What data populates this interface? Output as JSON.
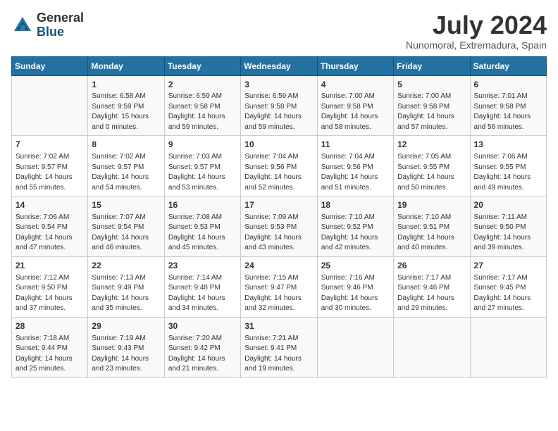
{
  "logo": {
    "general": "General",
    "blue": "Blue"
  },
  "title": "July 2024",
  "location": "Nunomoral, Extremadura, Spain",
  "days_of_week": [
    "Sunday",
    "Monday",
    "Tuesday",
    "Wednesday",
    "Thursday",
    "Friday",
    "Saturday"
  ],
  "weeks": [
    [
      {
        "day": "",
        "content": ""
      },
      {
        "day": "1",
        "content": "Sunrise: 6:58 AM\nSunset: 9:59 PM\nDaylight: 15 hours\nand 0 minutes."
      },
      {
        "day": "2",
        "content": "Sunrise: 6:59 AM\nSunset: 9:58 PM\nDaylight: 14 hours\nand 59 minutes."
      },
      {
        "day": "3",
        "content": "Sunrise: 6:59 AM\nSunset: 9:58 PM\nDaylight: 14 hours\nand 59 minutes."
      },
      {
        "day": "4",
        "content": "Sunrise: 7:00 AM\nSunset: 9:58 PM\nDaylight: 14 hours\nand 58 minutes."
      },
      {
        "day": "5",
        "content": "Sunrise: 7:00 AM\nSunset: 9:58 PM\nDaylight: 14 hours\nand 57 minutes."
      },
      {
        "day": "6",
        "content": "Sunrise: 7:01 AM\nSunset: 9:58 PM\nDaylight: 14 hours\nand 56 minutes."
      }
    ],
    [
      {
        "day": "7",
        "content": "Sunrise: 7:02 AM\nSunset: 9:57 PM\nDaylight: 14 hours\nand 55 minutes."
      },
      {
        "day": "8",
        "content": "Sunrise: 7:02 AM\nSunset: 9:57 PM\nDaylight: 14 hours\nand 54 minutes."
      },
      {
        "day": "9",
        "content": "Sunrise: 7:03 AM\nSunset: 9:57 PM\nDaylight: 14 hours\nand 53 minutes."
      },
      {
        "day": "10",
        "content": "Sunrise: 7:04 AM\nSunset: 9:56 PM\nDaylight: 14 hours\nand 52 minutes."
      },
      {
        "day": "11",
        "content": "Sunrise: 7:04 AM\nSunset: 9:56 PM\nDaylight: 14 hours\nand 51 minutes."
      },
      {
        "day": "12",
        "content": "Sunrise: 7:05 AM\nSunset: 9:55 PM\nDaylight: 14 hours\nand 50 minutes."
      },
      {
        "day": "13",
        "content": "Sunrise: 7:06 AM\nSunset: 9:55 PM\nDaylight: 14 hours\nand 49 minutes."
      }
    ],
    [
      {
        "day": "14",
        "content": "Sunrise: 7:06 AM\nSunset: 9:54 PM\nDaylight: 14 hours\nand 47 minutes."
      },
      {
        "day": "15",
        "content": "Sunrise: 7:07 AM\nSunset: 9:54 PM\nDaylight: 14 hours\nand 46 minutes."
      },
      {
        "day": "16",
        "content": "Sunrise: 7:08 AM\nSunset: 9:53 PM\nDaylight: 14 hours\nand 45 minutes."
      },
      {
        "day": "17",
        "content": "Sunrise: 7:09 AM\nSunset: 9:53 PM\nDaylight: 14 hours\nand 43 minutes."
      },
      {
        "day": "18",
        "content": "Sunrise: 7:10 AM\nSunset: 9:52 PM\nDaylight: 14 hours\nand 42 minutes."
      },
      {
        "day": "19",
        "content": "Sunrise: 7:10 AM\nSunset: 9:51 PM\nDaylight: 14 hours\nand 40 minutes."
      },
      {
        "day": "20",
        "content": "Sunrise: 7:11 AM\nSunset: 9:50 PM\nDaylight: 14 hours\nand 39 minutes."
      }
    ],
    [
      {
        "day": "21",
        "content": "Sunrise: 7:12 AM\nSunset: 9:50 PM\nDaylight: 14 hours\nand 37 minutes."
      },
      {
        "day": "22",
        "content": "Sunrise: 7:13 AM\nSunset: 9:49 PM\nDaylight: 14 hours\nand 35 minutes."
      },
      {
        "day": "23",
        "content": "Sunrise: 7:14 AM\nSunset: 9:48 PM\nDaylight: 14 hours\nand 34 minutes."
      },
      {
        "day": "24",
        "content": "Sunrise: 7:15 AM\nSunset: 9:47 PM\nDaylight: 14 hours\nand 32 minutes."
      },
      {
        "day": "25",
        "content": "Sunrise: 7:16 AM\nSunset: 9:46 PM\nDaylight: 14 hours\nand 30 minutes."
      },
      {
        "day": "26",
        "content": "Sunrise: 7:17 AM\nSunset: 9:46 PM\nDaylight: 14 hours\nand 29 minutes."
      },
      {
        "day": "27",
        "content": "Sunrise: 7:17 AM\nSunset: 9:45 PM\nDaylight: 14 hours\nand 27 minutes."
      }
    ],
    [
      {
        "day": "28",
        "content": "Sunrise: 7:18 AM\nSunset: 9:44 PM\nDaylight: 14 hours\nand 25 minutes."
      },
      {
        "day": "29",
        "content": "Sunrise: 7:19 AM\nSunset: 9:43 PM\nDaylight: 14 hours\nand 23 minutes."
      },
      {
        "day": "30",
        "content": "Sunrise: 7:20 AM\nSunset: 9:42 PM\nDaylight: 14 hours\nand 21 minutes."
      },
      {
        "day": "31",
        "content": "Sunrise: 7:21 AM\nSunset: 9:41 PM\nDaylight: 14 hours\nand 19 minutes."
      },
      {
        "day": "",
        "content": ""
      },
      {
        "day": "",
        "content": ""
      },
      {
        "day": "",
        "content": ""
      }
    ]
  ]
}
